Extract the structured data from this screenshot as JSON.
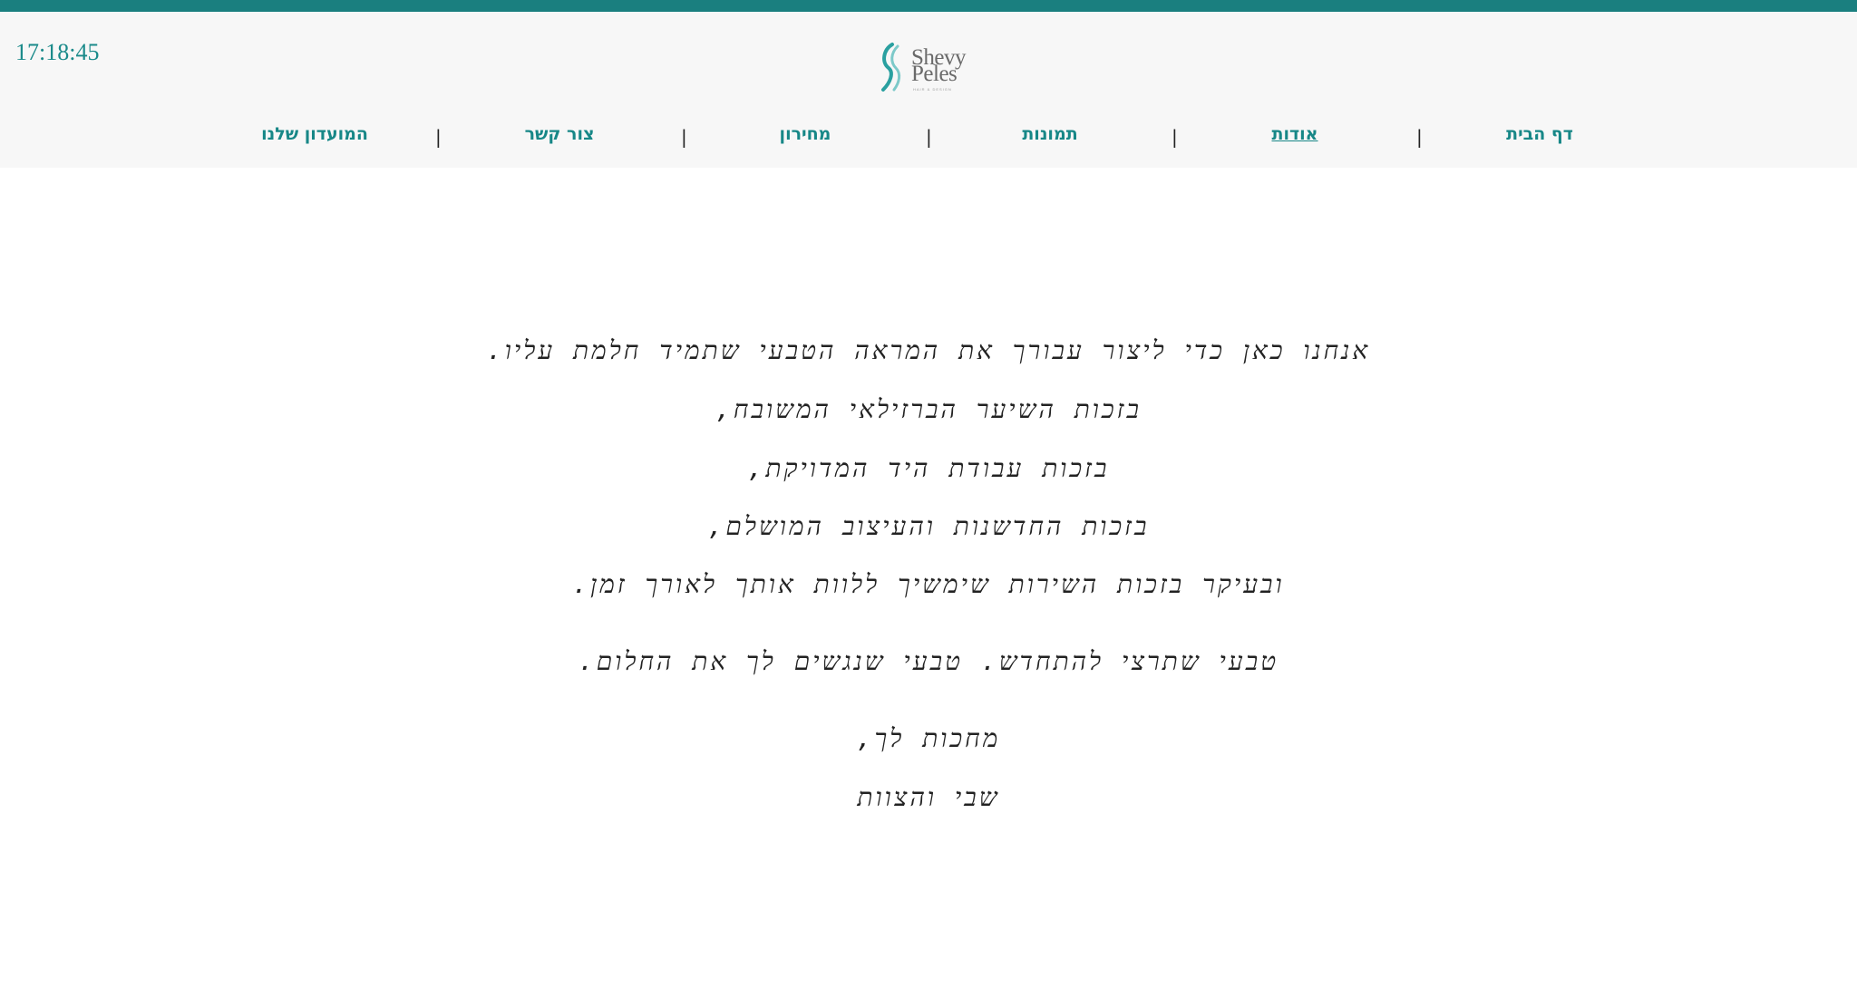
{
  "header": {
    "clock": "17:18:45",
    "logo": {
      "line1": "Shevy",
      "line2": "Peles",
      "tagline": "HAIR & DESIGN"
    },
    "brand_color": "#178787",
    "nav": [
      {
        "label": "דף הבית",
        "active": false
      },
      {
        "label": "אודות",
        "active": true
      },
      {
        "label": "תמונות",
        "active": false
      },
      {
        "label": "מחירון",
        "active": false
      },
      {
        "label": "צור קשר",
        "active": false
      },
      {
        "label": "המועדון שלנו",
        "active": false
      }
    ],
    "separator": "|"
  },
  "content": {
    "lines": [
      "אנחנו כאן כדי ליצור עבורך את המראה הטבעי שתמיד חלמת עליו.",
      "בזכות השיער הברזילאי המשובח,",
      "בזכות עבודת היד המדויקת,",
      "בזכות החדשנות והעיצוב המושלם,",
      "ובעיקר בזכות השירות שימשיך ללוות אותך לאורך זמן.",
      "טבעי שתרצי להתחדש. טבעי שנגשים לך את החלום.",
      "מחכות לך,",
      "שבי והצוות"
    ]
  }
}
